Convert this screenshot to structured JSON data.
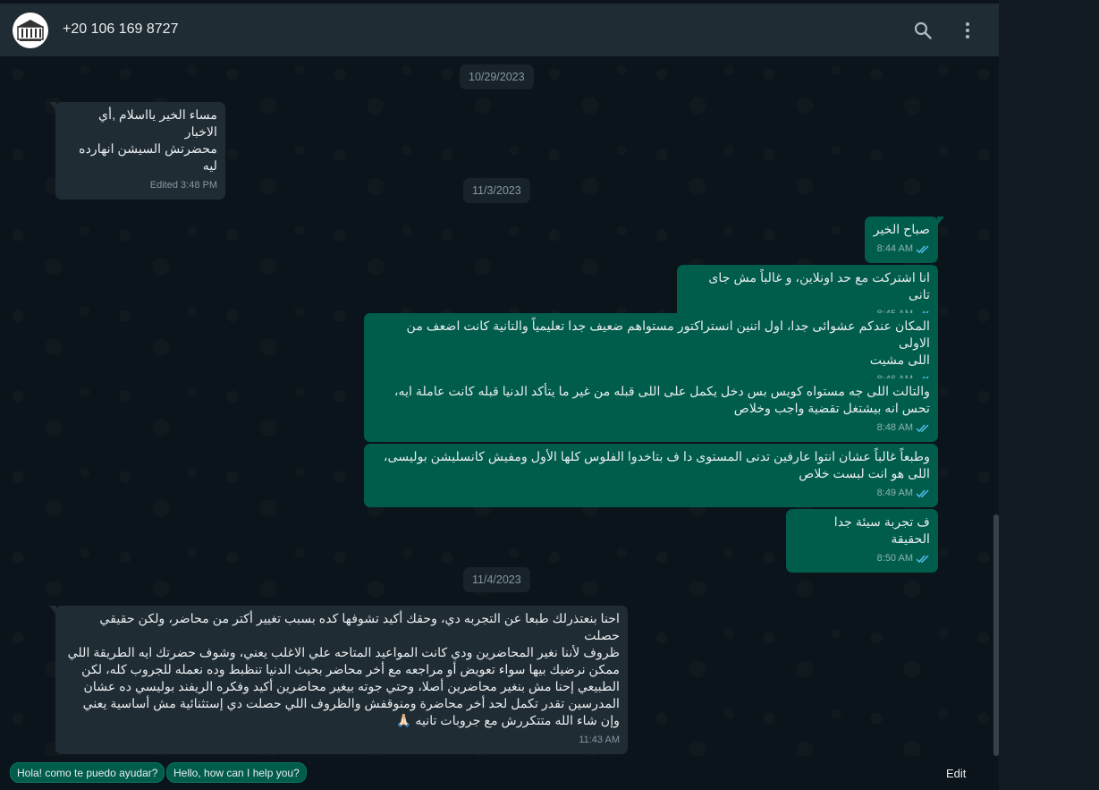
{
  "header": {
    "contact_name": "+20 106 169 8727",
    "avatar_label": "Group Photo"
  },
  "dates": [
    "10/29/2023",
    "11/3/2023",
    "11/4/2023"
  ],
  "messages": [
    {
      "dir": "in",
      "text": "مساء الخير يااسلام ,أي الاخبار\nمحضرتش السيشن انهارده ليه",
      "time": "Edited 3:48 PM"
    },
    {
      "dir": "out",
      "text": "صباح الخير",
      "time": "8:44 AM"
    },
    {
      "dir": "out",
      "text": "انا اشتركت مع حد اونلاين، و غالباً مش جاى تانى",
      "time": "8:45 AM"
    },
    {
      "dir": "out",
      "text": "المكان عندكم عشوائى جدا، اول اتنين انستراكتور مستواهم ضعيف جدا تعليمياً والتانية كانت اضعف من الاولى\nاللى مشيت",
      "time": "8:46 AM"
    },
    {
      "dir": "out",
      "text": "والتالت اللى جه مستواه كويس بس دخل يكمل على اللى قبله من غير ما يتأكد الدنيا قبله كانت عاملة ايه،\nتحس انه بيشتغل تقضية واجب وخلاص",
      "time": "8:48 AM"
    },
    {
      "dir": "out",
      "text": "وطبعاً غالباً عشان انتوا عارفين تدنى المستوى دا ف بتاخدوا الفلوس كلها الأول ومفيش كانسليشن بوليسى،\nاللى هو انت لبست خلاص",
      "time": "8:49 AM"
    },
    {
      "dir": "out",
      "text": "ف تجربة سيئة جدا الحقيقة",
      "time": "8:50 AM"
    },
    {
      "dir": "in",
      "text": "احنا بنعتذرلك طبعا عن التجربه دي، وحقك أكيد تشوفها كده بسبب تغيير أكتر من محاضر، ولكن حقيقي حصلت\nظروف  لأننا نغير المحاضرين ودي كانت المواعيد المتاحه علي الاغلب يعني، وشوف حضرتك ايه الطريقة اللي\nممكن نرضيك بيها سواء تعويض أو مراجعه مع أخر محاضر بحيث الدنيا تنظبط وده نعمله للجروب كله، لكن\nالطبيعي إحنا مش بنغير محاضرين أصلا، وحتي جوته بيغير محاضرين أكيد وفكره الريفند بوليسي ده عشان\nالمدرسين تقدر تكمل لحد أخر محاضرة ومنوقفش والظروف اللي حصلت دي إستثنائية مش أساسية يعني\nوإن شاء الله متتكررش مع جروبات تانيه 🙏🏻",
      "time": "11:43 AM"
    }
  ],
  "quick_replies": [
    "Hola! como te puedo ayudar?",
    "Hello, how can I help you?"
  ],
  "edit_label": "Edit",
  "colors": {
    "incoming": "#202c33",
    "outgoing": "#005c4b",
    "background": "#0b141a",
    "ticks": "#53bdeb"
  }
}
